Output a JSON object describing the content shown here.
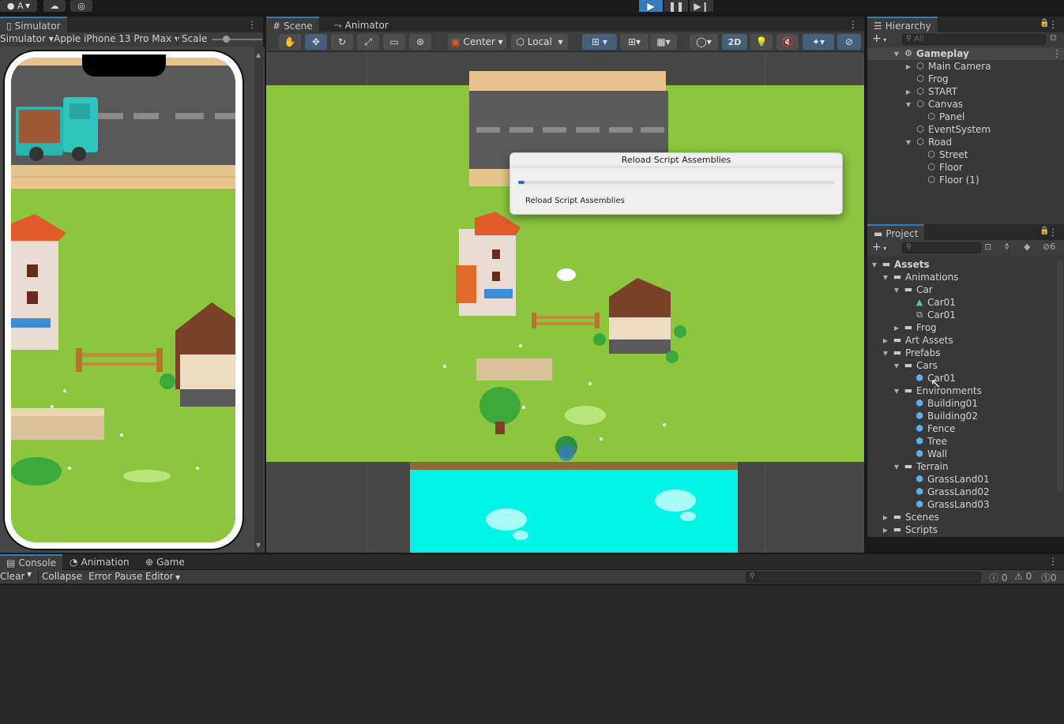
{
  "topbar": {
    "account_label": "A",
    "play_icon": "play-icon",
    "pause_icon": "pause-icon",
    "step_icon": "step-icon"
  },
  "simulator": {
    "tab": "Simulator",
    "mode": "Simulator",
    "device": "Apple iPhone 13 Pro Max",
    "scale_label": "Scale"
  },
  "scene": {
    "tabs": [
      "Scene",
      "Animator"
    ],
    "pivot": "Center",
    "space": "Local",
    "mode_2d": "2D"
  },
  "dialog": {
    "title": "Reload Script Assemblies",
    "status": "Reload Script Assemblies",
    "progress": 0.02
  },
  "hierarchy": {
    "tab": "Hierarchy",
    "search_placeholder": "All",
    "items": [
      {
        "label": "Gameplay"
      },
      {
        "label": "Main Camera"
      },
      {
        "label": "Frog"
      },
      {
        "label": "START"
      },
      {
        "label": "Canvas"
      },
      {
        "label": "Panel"
      },
      {
        "label": "EventSystem"
      },
      {
        "label": "Road"
      },
      {
        "label": "Street"
      },
      {
        "label": "Floor"
      },
      {
        "label": "Floor (1)"
      }
    ]
  },
  "project": {
    "tab": "Project",
    "hidden_count": "6",
    "items": [
      {
        "label": "Assets"
      },
      {
        "label": "Animations"
      },
      {
        "label": "Car"
      },
      {
        "label": "Car01"
      },
      {
        "label": "Car01"
      },
      {
        "label": "Frog"
      },
      {
        "label": "Art Assets"
      },
      {
        "label": "Prefabs"
      },
      {
        "label": "Cars"
      },
      {
        "label": "Car01"
      },
      {
        "label": "Environments"
      },
      {
        "label": "Building01"
      },
      {
        "label": "Building02"
      },
      {
        "label": "Fence"
      },
      {
        "label": "Tree"
      },
      {
        "label": "Wall"
      },
      {
        "label": "Terrain"
      },
      {
        "label": "GrassLand01"
      },
      {
        "label": "GrassLand02"
      },
      {
        "label": "GrassLand03"
      },
      {
        "label": "Scenes"
      },
      {
        "label": "Scripts"
      }
    ]
  },
  "console": {
    "tabs": [
      "Console",
      "Animation",
      "Game"
    ],
    "clear": "Clear",
    "collapse": "Collapse",
    "error_pause": "Error Pause",
    "editor": "Editor",
    "log_count": "0",
    "warn_count": "0",
    "error_count": "0"
  },
  "colors": {
    "accent": "#3a79bb",
    "grass": "#8cc63f",
    "road": "#555555",
    "water": "#00f5e6"
  }
}
